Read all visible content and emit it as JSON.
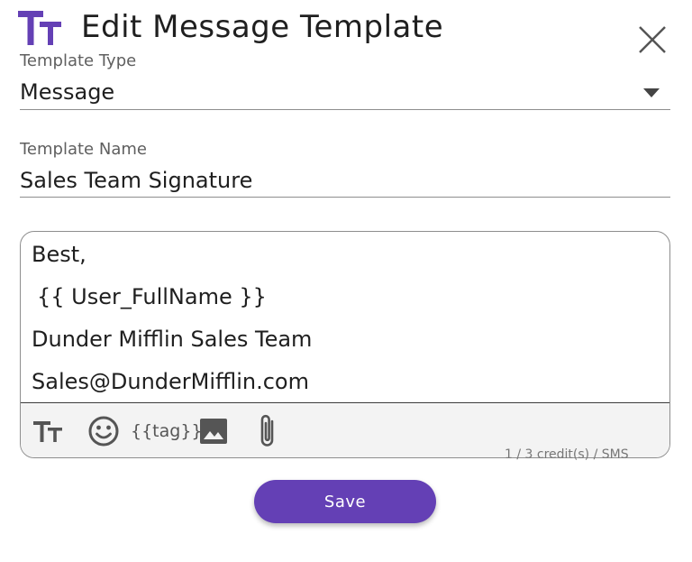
{
  "dialog": {
    "title": "Edit Message Template",
    "icon": "text-format-icon",
    "close_icon": "close-icon",
    "accent_color": "#6440b5"
  },
  "template_type": {
    "label": "Template Type",
    "value": "Message"
  },
  "template_name": {
    "label": "Template Name",
    "value": "Sales Team Signature"
  },
  "message": {
    "lines": [
      "Best,",
      "{{ User_FullName }}",
      "Dunder Mifflin Sales Team",
      "Sales@DunderMifflin.com"
    ]
  },
  "toolbar": {
    "items": [
      {
        "icon": "text-format-icon"
      },
      {
        "icon": "emoji-icon"
      },
      {
        "icon": "tag-icon",
        "label": "{{tag}}"
      },
      {
        "icon": "image-icon"
      },
      {
        "icon": "attachment-icon"
      }
    ]
  },
  "credits": "1 / 3 credit(s) / SMS",
  "save_label": "Save"
}
